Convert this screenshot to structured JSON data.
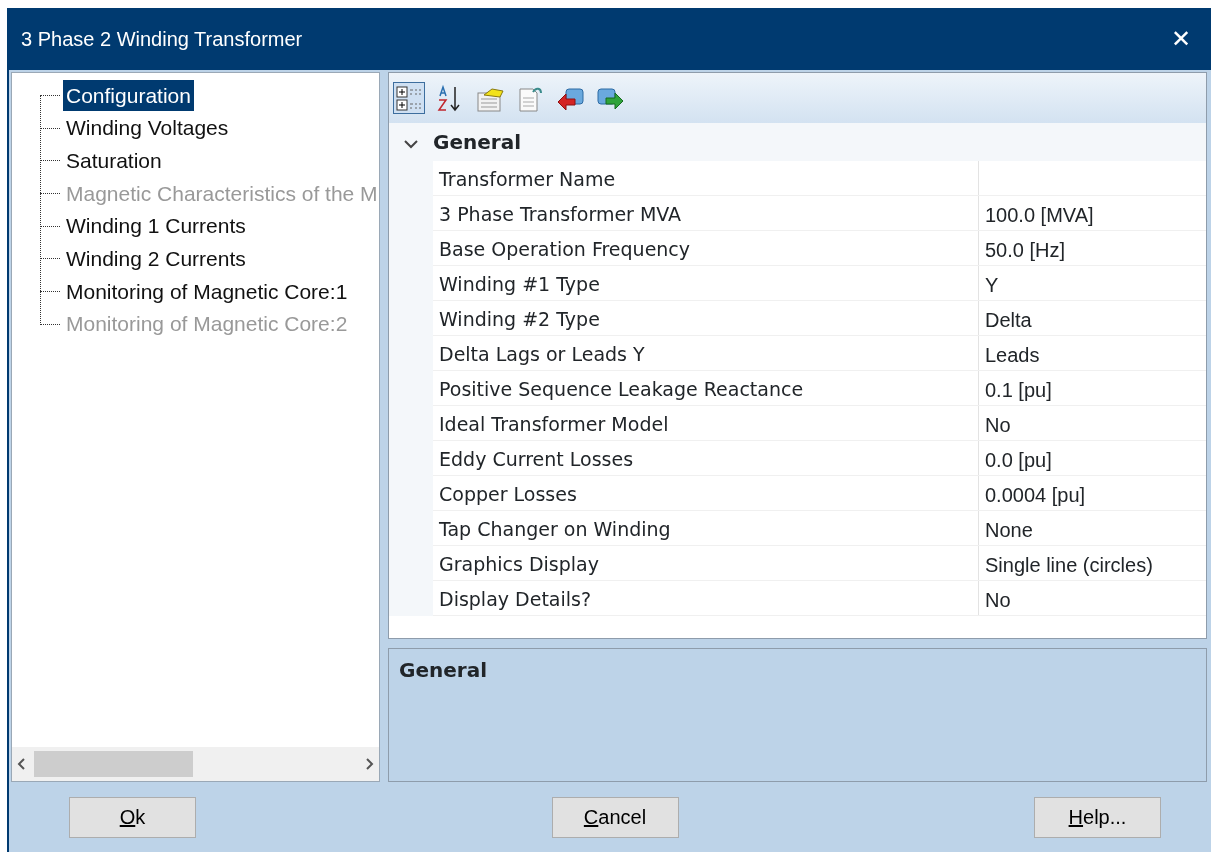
{
  "window": {
    "title": "3 Phase 2 Winding Transformer",
    "close": "✕"
  },
  "tree": {
    "items": [
      {
        "label": "Configuration",
        "selected": true,
        "disabled": false
      },
      {
        "label": "Winding Voltages",
        "selected": false,
        "disabled": false
      },
      {
        "label": "Saturation",
        "selected": false,
        "disabled": false
      },
      {
        "label": "Magnetic Characteristics of the M",
        "selected": false,
        "disabled": true
      },
      {
        "label": "Winding 1 Currents",
        "selected": false,
        "disabled": false
      },
      {
        "label": "Winding 2 Currents",
        "selected": false,
        "disabled": false
      },
      {
        "label": "Monitoring of Magnetic Core:1",
        "selected": false,
        "disabled": false
      },
      {
        "label": "Monitoring of Magnetic Core:2",
        "selected": false,
        "disabled": true
      }
    ]
  },
  "toolbar": [
    {
      "kind": "categorized",
      "selected": true
    },
    {
      "kind": "alphabetical",
      "selected": false
    },
    {
      "kind": "properties",
      "selected": false
    },
    {
      "kind": "pages",
      "selected": false
    },
    {
      "kind": "import",
      "selected": false
    },
    {
      "kind": "export",
      "selected": false
    }
  ],
  "grid": {
    "category": {
      "label": "General",
      "expanded": true
    },
    "rows": [
      {
        "name": "Transformer Name",
        "value": ""
      },
      {
        "name": "3 Phase Transformer MVA",
        "value": "100.0 [MVA]"
      },
      {
        "name": "Base Operation Frequency",
        "value": "50.0 [Hz]"
      },
      {
        "name": "Winding #1 Type",
        "value": "Y"
      },
      {
        "name": "Winding #2 Type",
        "value": "Delta"
      },
      {
        "name": "Delta Lags or Leads Y",
        "value": "Leads"
      },
      {
        "name": "Positive Sequence Leakage Reactance",
        "value": "0.1 [pu]"
      },
      {
        "name": "Ideal Transformer Model",
        "value": "No"
      },
      {
        "name": "Eddy Current Losses",
        "value": "0.0 [pu]"
      },
      {
        "name": "Copper Losses",
        "value": "0.0004 [pu]"
      },
      {
        "name": "Tap Changer on Winding",
        "value": "None"
      },
      {
        "name": "Graphics Display",
        "value": "Single line (circles)"
      },
      {
        "name": "Display Details?",
        "value": "No"
      }
    ]
  },
  "description": {
    "title": "General"
  },
  "buttons": [
    "Ok",
    "Cancel",
    "Help..."
  ]
}
